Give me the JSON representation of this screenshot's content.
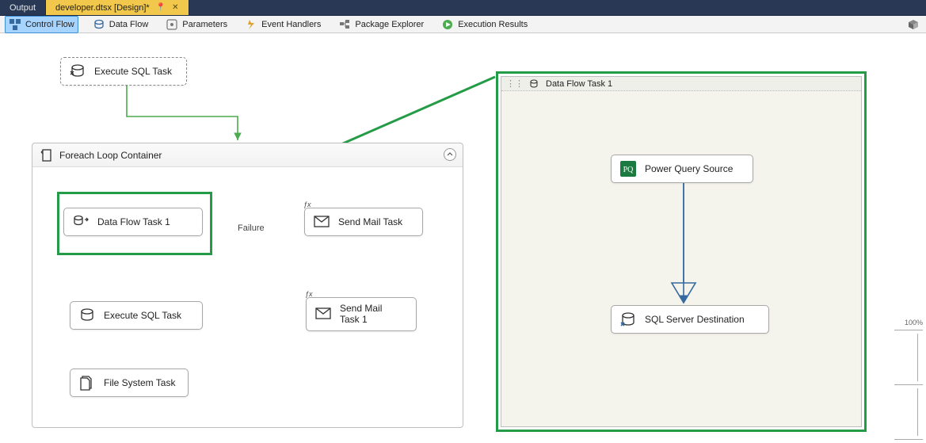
{
  "tabs": {
    "output": "Output",
    "active": "developer.dtsx [Design]*"
  },
  "toolbar": {
    "control_flow": "Control Flow",
    "data_flow": "Data Flow",
    "parameters": "Parameters",
    "event_handlers": "Event Handlers",
    "package_explorer": "Package Explorer",
    "execution_results": "Execution Results"
  },
  "tasks": {
    "exec_sql_top": "Execute SQL Task",
    "foreach_container": "Foreach Loop Container",
    "data_flow_1": "Data Flow Task 1",
    "send_mail": "Send Mail Task",
    "exec_sql_inner": "Execute SQL Task",
    "send_mail_1": "Send Mail\nTask 1",
    "file_system": "File System Task",
    "failure_label": "Failure"
  },
  "detail_panel": {
    "title": "Data Flow Task 1",
    "power_query_src": "Power Query Source",
    "sql_dest": "SQL Server Destination"
  },
  "zoom": {
    "percent": "100%"
  },
  "colors": {
    "green": "#249b46",
    "success_arrow": "#4aab4f",
    "failure_arrow": "#b34b2a",
    "navy": "#356aa0"
  }
}
